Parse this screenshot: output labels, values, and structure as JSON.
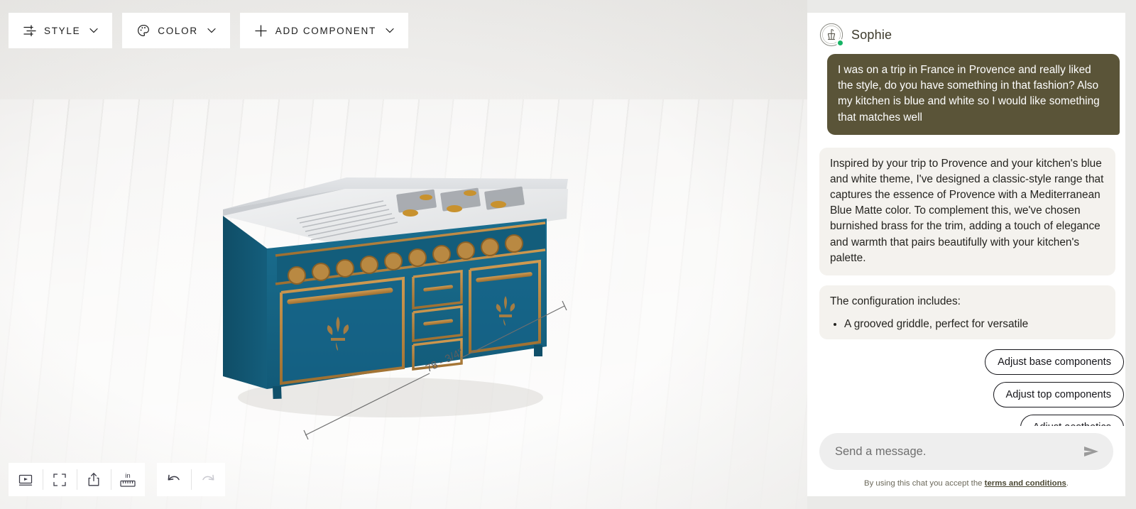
{
  "toolbar": {
    "buttons": [
      {
        "label": "STYLE",
        "icon": "sliders-icon"
      },
      {
        "label": "COLOR",
        "icon": "palette-icon"
      },
      {
        "label": "ADD COMPONENT",
        "icon": "plus-icon"
      }
    ]
  },
  "viewport": {
    "dimension_label": "78 - 3/4\"",
    "product": {
      "body_color": "#16607f",
      "trim_color": "#b5803c",
      "top_color": "#e8e9eb",
      "emblem": "fleur-de-lis"
    }
  },
  "view_tools": {
    "items": [
      {
        "name": "video-icon",
        "title": "Video"
      },
      {
        "name": "fullscreen-icon",
        "title": "Fullscreen"
      },
      {
        "name": "share-icon",
        "title": "Share"
      },
      {
        "name": "ruler-icon",
        "title": "Units",
        "unit": "in"
      }
    ],
    "history": [
      {
        "name": "undo-icon",
        "title": "Undo",
        "enabled": true
      },
      {
        "name": "redo-icon",
        "title": "Redo",
        "enabled": false
      }
    ]
  },
  "chat": {
    "agent_name": "Sophie",
    "status": "online",
    "user_message": "I was on a trip in France in Provence and really liked the style, do you have something in that fashion? Also my kitchen is blue and white so I would like something that matches well",
    "bot_message": "Inspired by your trip to Provence and your kitchen's blue and white theme, I've designed a classic-style range that captures the essence of Provence with a Mediterranean Blue Matte color. To complement this, we've chosen burnished brass for the trim, adding a touch of elegance and warmth that pairs beautifully with your kitchen's palette.",
    "config_title": "The configuration includes:",
    "config_items": [
      "A grooved griddle, perfect for versatile"
    ],
    "suggestions": [
      "Adjust base components",
      "Adjust top components",
      "Adjust aesthetics"
    ],
    "composer": {
      "placeholder": "Send a message.",
      "value": "",
      "send_icon": "send-icon"
    },
    "terms_prefix": "By using this chat you accept the ",
    "terms_link": "terms and conditions",
    "terms_suffix": "."
  },
  "colors": {
    "panel_bg": "#ffffff",
    "viewport_bg": "#eaeae8",
    "user_bubble": "#5a5438",
    "bot_bubble": "#f4f2ee",
    "online_dot": "#16b364",
    "accent_text": "#15151a"
  }
}
